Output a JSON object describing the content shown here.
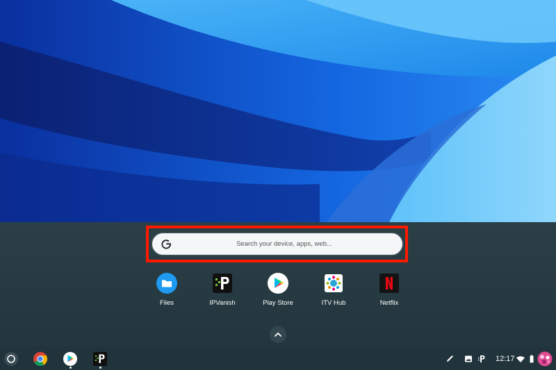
{
  "search": {
    "placeholder": "Search your device, apps, web...",
    "highlight_color": "#ff1a00"
  },
  "apps": [
    {
      "label": "Files",
      "icon": "files-folder-icon"
    },
    {
      "label": "IPVanish",
      "icon": "ipvanish-icon"
    },
    {
      "label": "Play Store",
      "icon": "play-store-icon"
    },
    {
      "label": "ITV Hub",
      "icon": "itv-hub-icon"
    },
    {
      "label": "Netflix",
      "icon": "netflix-icon"
    }
  ],
  "shelf": {
    "pinned": [
      "launcher-circle-icon",
      "chrome-icon",
      "play-store-icon",
      "ipvanish-icon"
    ],
    "tray": {
      "time": "12:17",
      "icons": [
        "stylus-icon",
        "screenshot-icon",
        "ipvanish-tray-icon",
        "wifi-icon",
        "battery-icon",
        "avatar"
      ]
    }
  }
}
